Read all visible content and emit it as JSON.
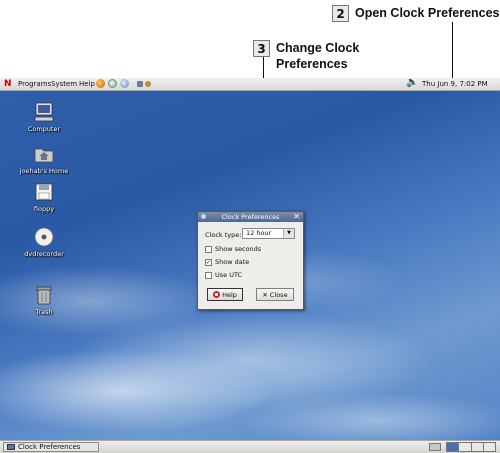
{
  "callouts": [
    {
      "number": "2",
      "text": "Open Clock Preferences"
    },
    {
      "number": "3",
      "text": "Change Clock Preferences"
    }
  ],
  "top_panel": {
    "logo": "N",
    "menus": [
      "Programs",
      "System",
      "Help"
    ],
    "clock": "Thu Jun  9,  7:02 PM"
  },
  "desktop_icons": [
    {
      "label": "Computer",
      "icon": "computer-icon"
    },
    {
      "label": "joehab's Home",
      "icon": "home-folder-icon"
    },
    {
      "label": "floppy",
      "icon": "floppy-icon"
    },
    {
      "label": "dvdrecorder",
      "icon": "dvd-icon"
    },
    {
      "label": "Trash",
      "icon": "trash-icon"
    }
  ],
  "dialog": {
    "title": "Clock Preferences",
    "clock_type_label": "Clock type:",
    "clock_type_value": "12 hour",
    "options": [
      {
        "label": "Show seconds",
        "checked": false
      },
      {
        "label": "Show date",
        "checked": true
      },
      {
        "label": "Use UTC",
        "checked": false
      }
    ],
    "help_label": "Help",
    "close_label": "Close"
  },
  "taskbar": {
    "task_label": "Clock Preferences"
  }
}
